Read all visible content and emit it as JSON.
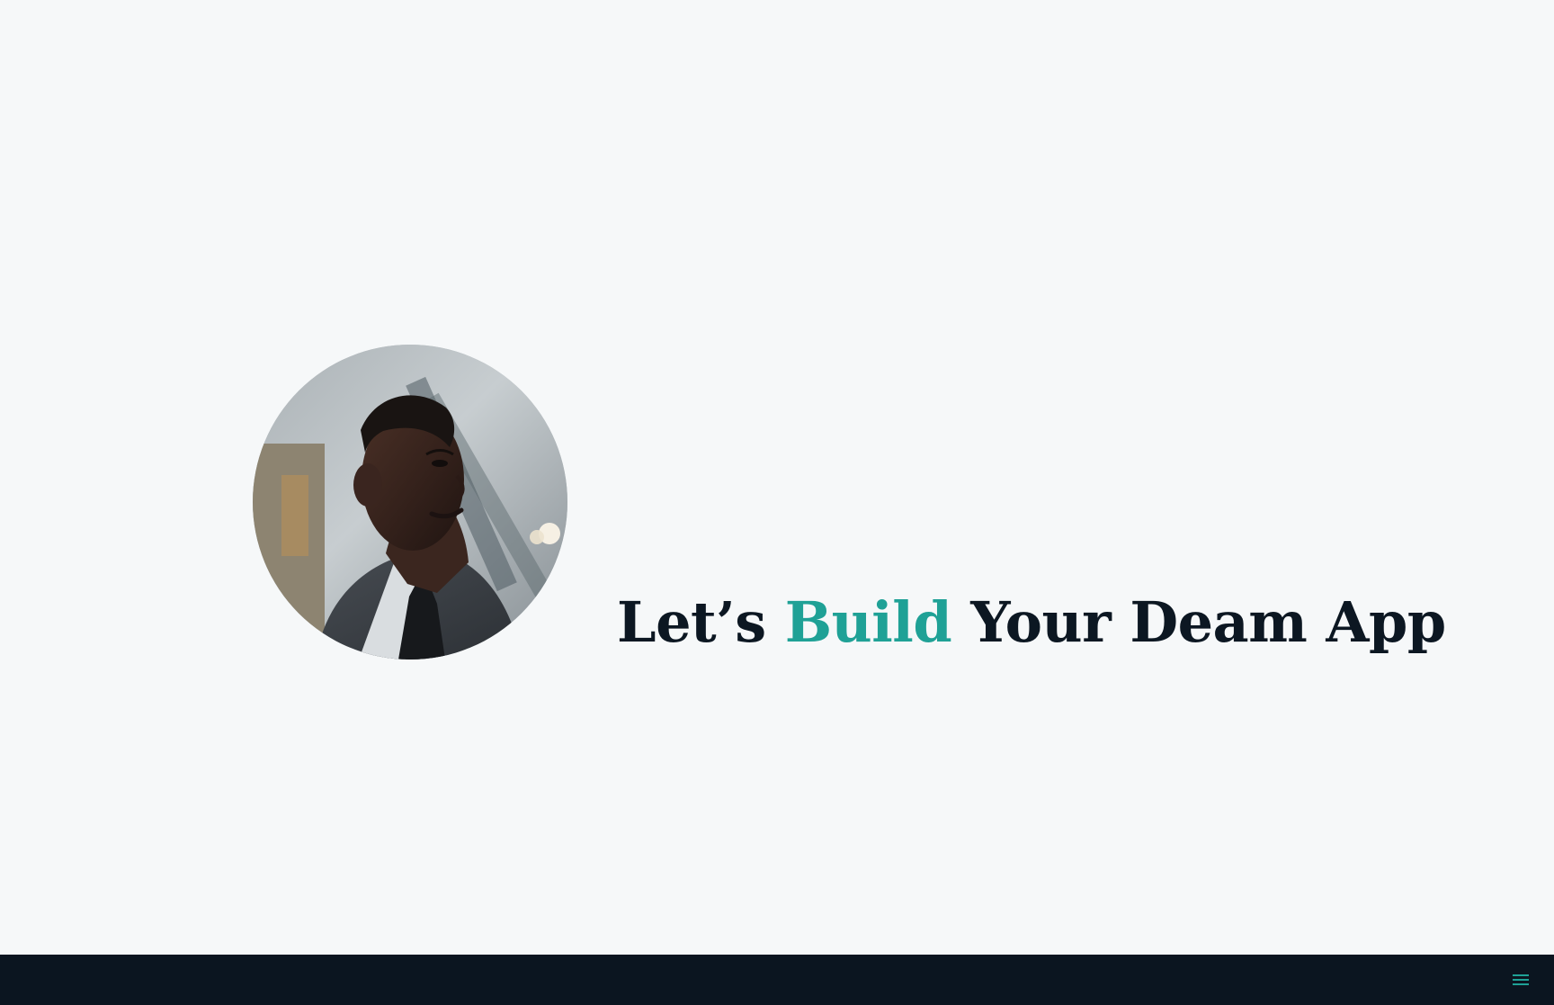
{
  "hero": {
    "headline_part1": "Let’s ",
    "headline_accent": "Build",
    "headline_part2": " Your Deam App",
    "accent_color": "#1fa196",
    "text_color": "#0c1722"
  },
  "colors": {
    "background": "#f6f8f9",
    "footer_background": "#0b1520",
    "menu_icon": "#1fa196"
  },
  "footer": {
    "menu_icon_name": "hamburger-menu-icon"
  }
}
